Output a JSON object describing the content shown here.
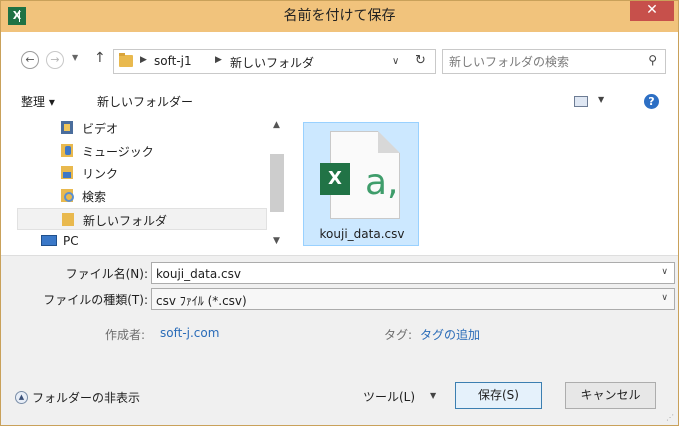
{
  "title_bar": {
    "title": "名前を付けて保存",
    "app_icon": "excel-icon",
    "close_label": "✕"
  },
  "address_bar": {
    "breadcrumbs": [
      "soft-j1",
      "新しいフォルダ"
    ],
    "search_placeholder": "新しいフォルダの検索"
  },
  "toolbar": {
    "organize_label": "整理 ▾",
    "new_folder_label": "新しいフォルダー"
  },
  "nav_pane": {
    "items": [
      {
        "label": "ビデオ",
        "icon": "video-folder-icon"
      },
      {
        "label": "ミュージック",
        "icon": "music-folder-icon"
      },
      {
        "label": "リンク",
        "icon": "link-folder-icon"
      },
      {
        "label": "検索",
        "icon": "search-folder-icon"
      },
      {
        "label": "新しいフォルダ",
        "icon": "folder-icon",
        "selected": true
      },
      {
        "label": "PC",
        "icon": "pc-icon"
      }
    ]
  },
  "files": [
    {
      "name": "kouji_data.csv",
      "icon": "excel-csv-file-icon"
    }
  ],
  "form": {
    "file_name_label": "ファイル名(N):",
    "file_name_value": "kouji_data.csv",
    "file_type_label": "ファイルの種類(T):",
    "file_type_value": "csv ﾌｧｲﾙ (*.csv)",
    "author_label": "作成者:",
    "author_value": "soft-j.com",
    "tags_label": "タグ:",
    "tags_value": "タグの追加"
  },
  "footer": {
    "hide_folders_label": "フォルダーの非表示",
    "tools_label": "ツール(L)",
    "save_label": "保存(S)",
    "cancel_label": "キャンセル"
  },
  "colors": {
    "title_bar": "#f1c37c",
    "close_button": "#c7504b",
    "selection": "#cce8ff",
    "link": "#2a6cb8"
  }
}
